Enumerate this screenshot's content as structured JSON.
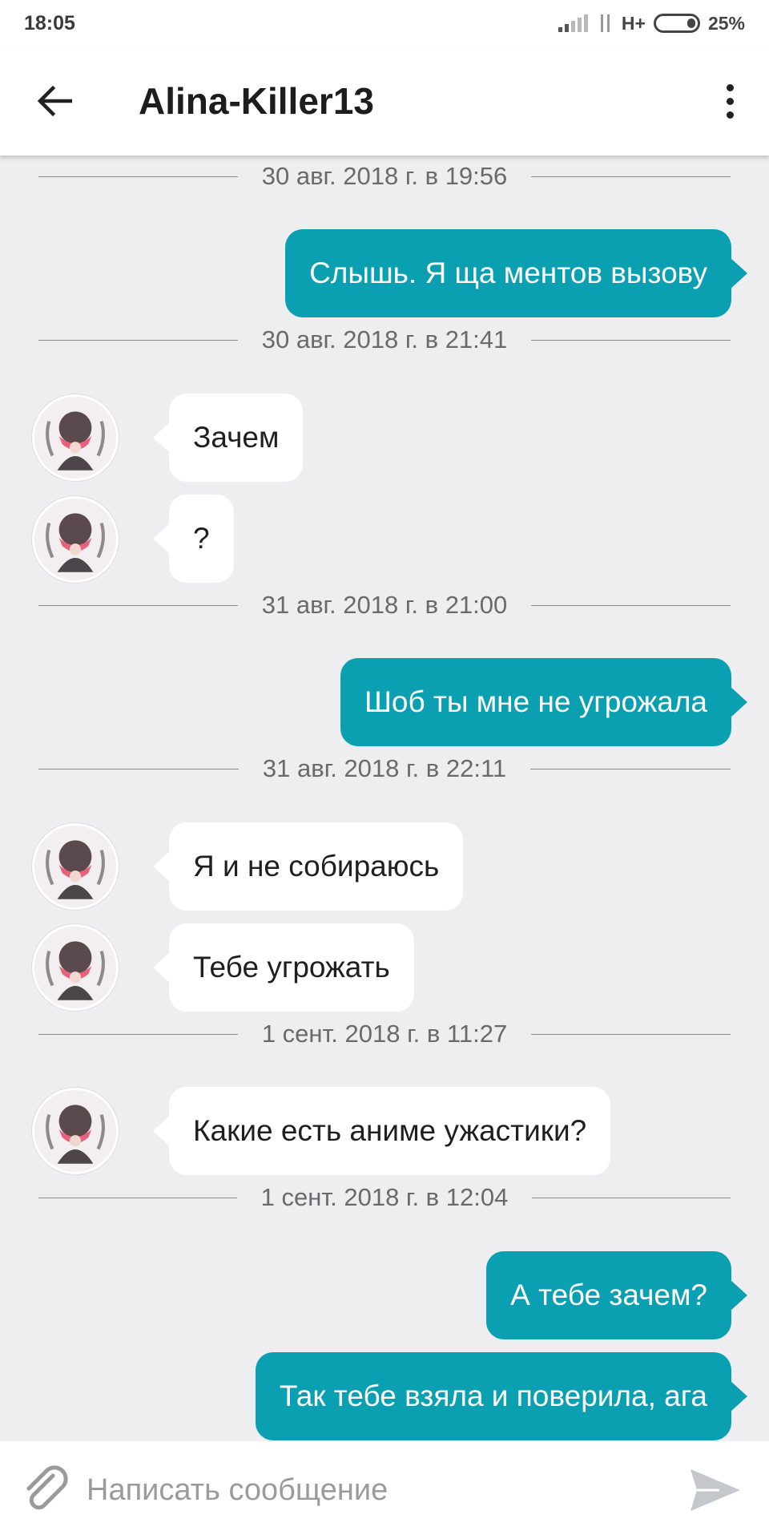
{
  "status_bar": {
    "time": "18:05",
    "network": "H+",
    "battery": "25%"
  },
  "header": {
    "title": "Alina-Killer13",
    "back_icon": "arrow-left-icon",
    "menu_icon": "more-vertical-icon"
  },
  "conversation": {
    "dates": [
      "30 авг. 2018 г. в 19:56",
      "30 авг. 2018 г. в 21:41",
      "31 авг. 2018 г. в 21:00",
      "31 авг. 2018 г. в 22:11",
      "1 сент. 2018 г. в 11:27",
      "1 сент. 2018 г. в 12:04"
    ],
    "messages": [
      {
        "direction": "outgoing",
        "text": "Слышь. Я ща ментов вызову"
      },
      {
        "direction": "incoming",
        "text": "Зачем"
      },
      {
        "direction": "incoming",
        "text": "?"
      },
      {
        "direction": "outgoing",
        "text": "Шоб ты мне не угрожала"
      },
      {
        "direction": "incoming",
        "text": "Я и не собираюсь"
      },
      {
        "direction": "incoming",
        "text": "Тебе угрожать"
      },
      {
        "direction": "incoming",
        "text": "Какие есть аниме ужастики?"
      },
      {
        "direction": "outgoing",
        "text": "А тебе зачем?"
      },
      {
        "direction": "outgoing",
        "text": "Так тебе взяла и поверила, ага"
      }
    ]
  },
  "composer": {
    "placeholder": "Написать сообщение",
    "value": "",
    "attach_icon": "paperclip-icon",
    "send_icon": "send-icon"
  },
  "colors": {
    "accent": "#0aa0b2",
    "background": "#eeedf0",
    "incoming_bubble": "#ffffff"
  }
}
